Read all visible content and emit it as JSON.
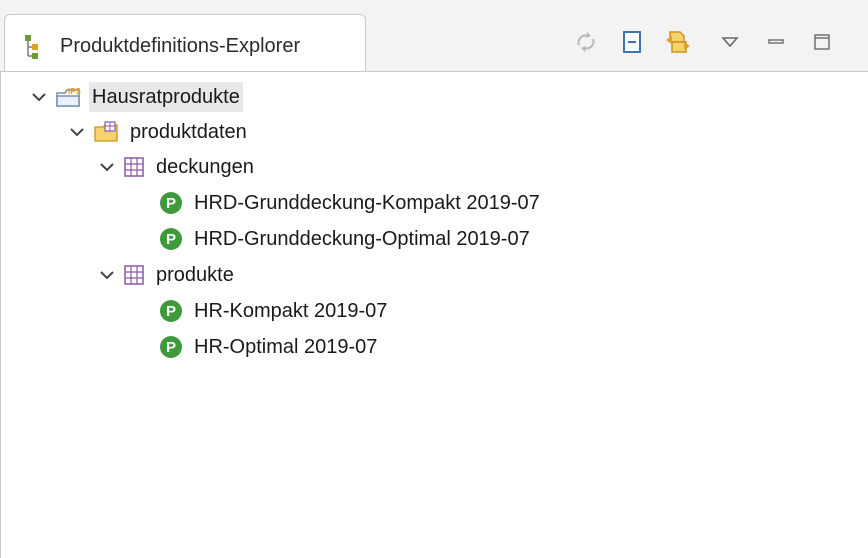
{
  "view": {
    "title": "Produktdefinitions-Explorer",
    "icon": "product-explorer-icon"
  },
  "toolbar": {
    "buttons": [
      {
        "name": "sync-icon",
        "tooltip": ""
      },
      {
        "name": "collapse-all-icon",
        "tooltip": ""
      },
      {
        "name": "link-with-editor-icon",
        "tooltip": ""
      },
      {
        "name": "view-menu-icon",
        "tooltip": ""
      },
      {
        "name": "minimize-icon",
        "tooltip": ""
      },
      {
        "name": "maximize-icon",
        "tooltip": ""
      }
    ]
  },
  "tree": {
    "root": {
      "label": "Hausratprodukte",
      "icon": "ips-project-icon",
      "expanded": true,
      "selected": true
    },
    "package": {
      "label": "produktdaten",
      "icon": "package-folder-icon",
      "expanded": true
    },
    "folders": [
      {
        "label": "deckungen",
        "icon": "table-folder-icon",
        "expanded": true,
        "items": [
          {
            "label": "HRD-Grunddeckung-Kompakt 2019-07",
            "icon": "product-cmpt-icon"
          },
          {
            "label": "HRD-Grunddeckung-Optimal 2019-07",
            "icon": "product-cmpt-icon"
          }
        ]
      },
      {
        "label": "produkte",
        "icon": "table-folder-icon",
        "expanded": true,
        "items": [
          {
            "label": "HR-Kompakt 2019-07",
            "icon": "product-cmpt-icon"
          },
          {
            "label": "HR-Optimal 2019-07",
            "icon": "product-cmpt-icon"
          }
        ]
      }
    ]
  },
  "colors": {
    "product_icon": "#3f9a3c",
    "folder_icon": "#8a5aa8",
    "package_folder": "#f0c35a",
    "toolbar_icon": "#e0a020"
  }
}
